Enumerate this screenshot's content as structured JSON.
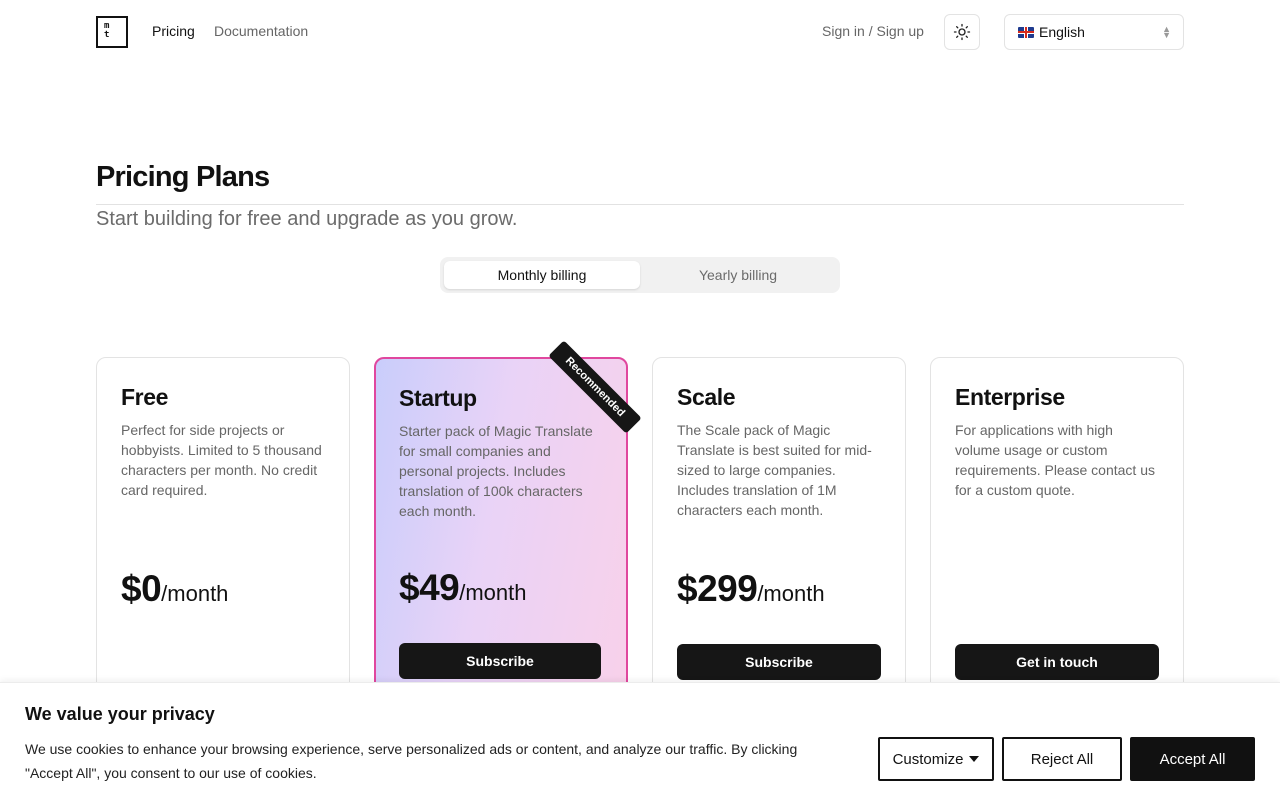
{
  "header": {
    "logo_top": "m",
    "logo_bottom": "t",
    "nav": {
      "pricing": "Pricing",
      "documentation": "Documentation"
    },
    "signin": "Sign in / Sign up",
    "theme_icon": "sun-icon",
    "language": {
      "flag": "uk-flag-icon",
      "selected": "English"
    }
  },
  "main": {
    "title": "Pricing Plans",
    "subtitle": "Start building for free and upgrade as you grow.",
    "billing": {
      "monthly": "Monthly billing",
      "yearly": "Yearly billing",
      "selected": "monthly"
    }
  },
  "plans": [
    {
      "name": "Free",
      "description": "Perfect for side projects or hobbyists. Limited to 5 thousand characters per month. No credit card required.",
      "price": "$0",
      "period": "/month",
      "button": ""
    },
    {
      "name": "Startup",
      "description": "Starter pack of Magic Translate for small companies and personal projects. Includes translation of 100k characters each month.",
      "price": "$49",
      "period": "/month",
      "button": "Subscribe",
      "badge": "Recommended"
    },
    {
      "name": "Scale",
      "description": "The Scale pack of Magic Translate is best suited for mid-sized to large companies. Includes translation of 1M characters each month.",
      "price": "$299",
      "period": "/month",
      "button": "Subscribe"
    },
    {
      "name": "Enterprise",
      "description": "For applications with high volume usage or custom requirements. Please contact us for a custom quote.",
      "price": "",
      "period": "",
      "button": "Get in touch"
    }
  ],
  "cookie": {
    "title": "We value your privacy",
    "text": "We use cookies to enhance your browsing experience, serve personalized ads or content, and analyze our traffic. By clicking \"Accept All\", you consent to our use of cookies.",
    "customize": "Customize",
    "reject": "Reject All",
    "accept": "Accept All"
  },
  "colors": {
    "accent_border": "#e0479e",
    "button_dark": "#161616",
    "muted_text": "#666666"
  }
}
